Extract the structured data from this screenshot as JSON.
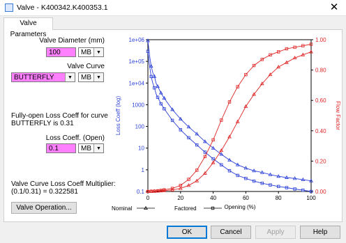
{
  "window": {
    "title": "Valve - K400342.K400353.1"
  },
  "tabs": [
    "Valve Parameters"
  ],
  "left": {
    "valve_diameter_label": "Valve Diameter (mm)",
    "valve_diameter_value": "100",
    "valve_diameter_unit": "MB",
    "valve_curve_label": "Valve Curve",
    "valve_curve_value": "BUTTERFLY",
    "valve_curve_unit": "MB",
    "fully_open_line1": "Fully-open Loss Coeff for curve",
    "fully_open_line2": "BUTTERFLY is 0.31",
    "loss_coeff_label": "Loss Coeff. (Open)",
    "loss_coeff_value": "0.1",
    "loss_coeff_unit": "MB",
    "multiplier_line1": "Valve Curve Loss Coeff Multiplier:",
    "multiplier_line2": "(0.1/0.31) = 0.322581",
    "valve_operation_button": "Valve Operation..."
  },
  "buttons": {
    "ok": "OK",
    "cancel": "Cancel",
    "apply": "Apply",
    "help": "Help"
  },
  "chart_data": {
    "type": "line",
    "xlabel": "Opening (%)",
    "ylabel_left": "Loss Coeff (log)",
    "ylabel_right": "Flow Factor",
    "xlim": [
      0,
      100
    ],
    "xticks": [
      0,
      20,
      40,
      60,
      80,
      100
    ],
    "ylim_left": [
      0.1,
      1000000
    ],
    "yscale_left": "log",
    "yticks_left": [
      "0.1",
      "1",
      "10",
      "100",
      "1000",
      "1e+04",
      "1e+05",
      "1e+06"
    ],
    "ylim_right": [
      0,
      1
    ],
    "yticks_right": [
      "0.00",
      "0.20",
      "0.40",
      "0.60",
      "0.80",
      "1.00"
    ],
    "legend": [
      {
        "name": "Nominal",
        "marker": "triangle"
      },
      {
        "name": "Factored",
        "marker": "square"
      }
    ],
    "colors": {
      "loss": "#2b3fd8",
      "flow": "#e02525"
    },
    "x": [
      0,
      1,
      2,
      3,
      4,
      5,
      6,
      7,
      8,
      9,
      10,
      15,
      20,
      25,
      30,
      35,
      40,
      45,
      50,
      55,
      60,
      65,
      70,
      75,
      80,
      85,
      90,
      95,
      100
    ],
    "series": [
      {
        "name": "Nominal",
        "axis": "left",
        "values": [
          900000,
          200000,
          60000,
          30000,
          20000,
          10000,
          7000,
          5000,
          3500,
          2600,
          2000,
          600,
          220,
          95,
          45,
          20,
          10,
          5.2,
          2.8,
          1.7,
          1.2,
          0.9,
          0.75,
          0.6,
          0.5,
          0.44,
          0.4,
          0.35,
          0.31
        ]
      },
      {
        "name": "Factored",
        "axis": "left",
        "values": [
          290000,
          65000,
          20000,
          10000,
          6000,
          3200,
          2200,
          1600,
          1100,
          850,
          650,
          190,
          70,
          30,
          14,
          6.5,
          3.2,
          1.7,
          0.9,
          0.55,
          0.4,
          0.3,
          0.24,
          0.2,
          0.17,
          0.15,
          0.13,
          0.115,
          0.1
        ]
      },
      {
        "name": "Nominal",
        "axis": "right",
        "values": [
          0,
          0,
          0.001,
          0.001,
          0.002,
          0.002,
          0.003,
          0.003,
          0.004,
          0.005,
          0.006,
          0.01,
          0.02,
          0.04,
          0.07,
          0.12,
          0.19,
          0.27,
          0.36,
          0.46,
          0.56,
          0.64,
          0.71,
          0.77,
          0.82,
          0.85,
          0.88,
          0.9,
          0.92
        ]
      },
      {
        "name": "Factored",
        "axis": "right",
        "values": [
          0,
          0,
          0.001,
          0.001,
          0.002,
          0.003,
          0.004,
          0.005,
          0.007,
          0.009,
          0.011,
          0.02,
          0.04,
          0.08,
          0.14,
          0.23,
          0.34,
          0.47,
          0.59,
          0.69,
          0.77,
          0.83,
          0.87,
          0.9,
          0.92,
          0.94,
          0.95,
          0.96,
          0.97
        ]
      }
    ]
  }
}
